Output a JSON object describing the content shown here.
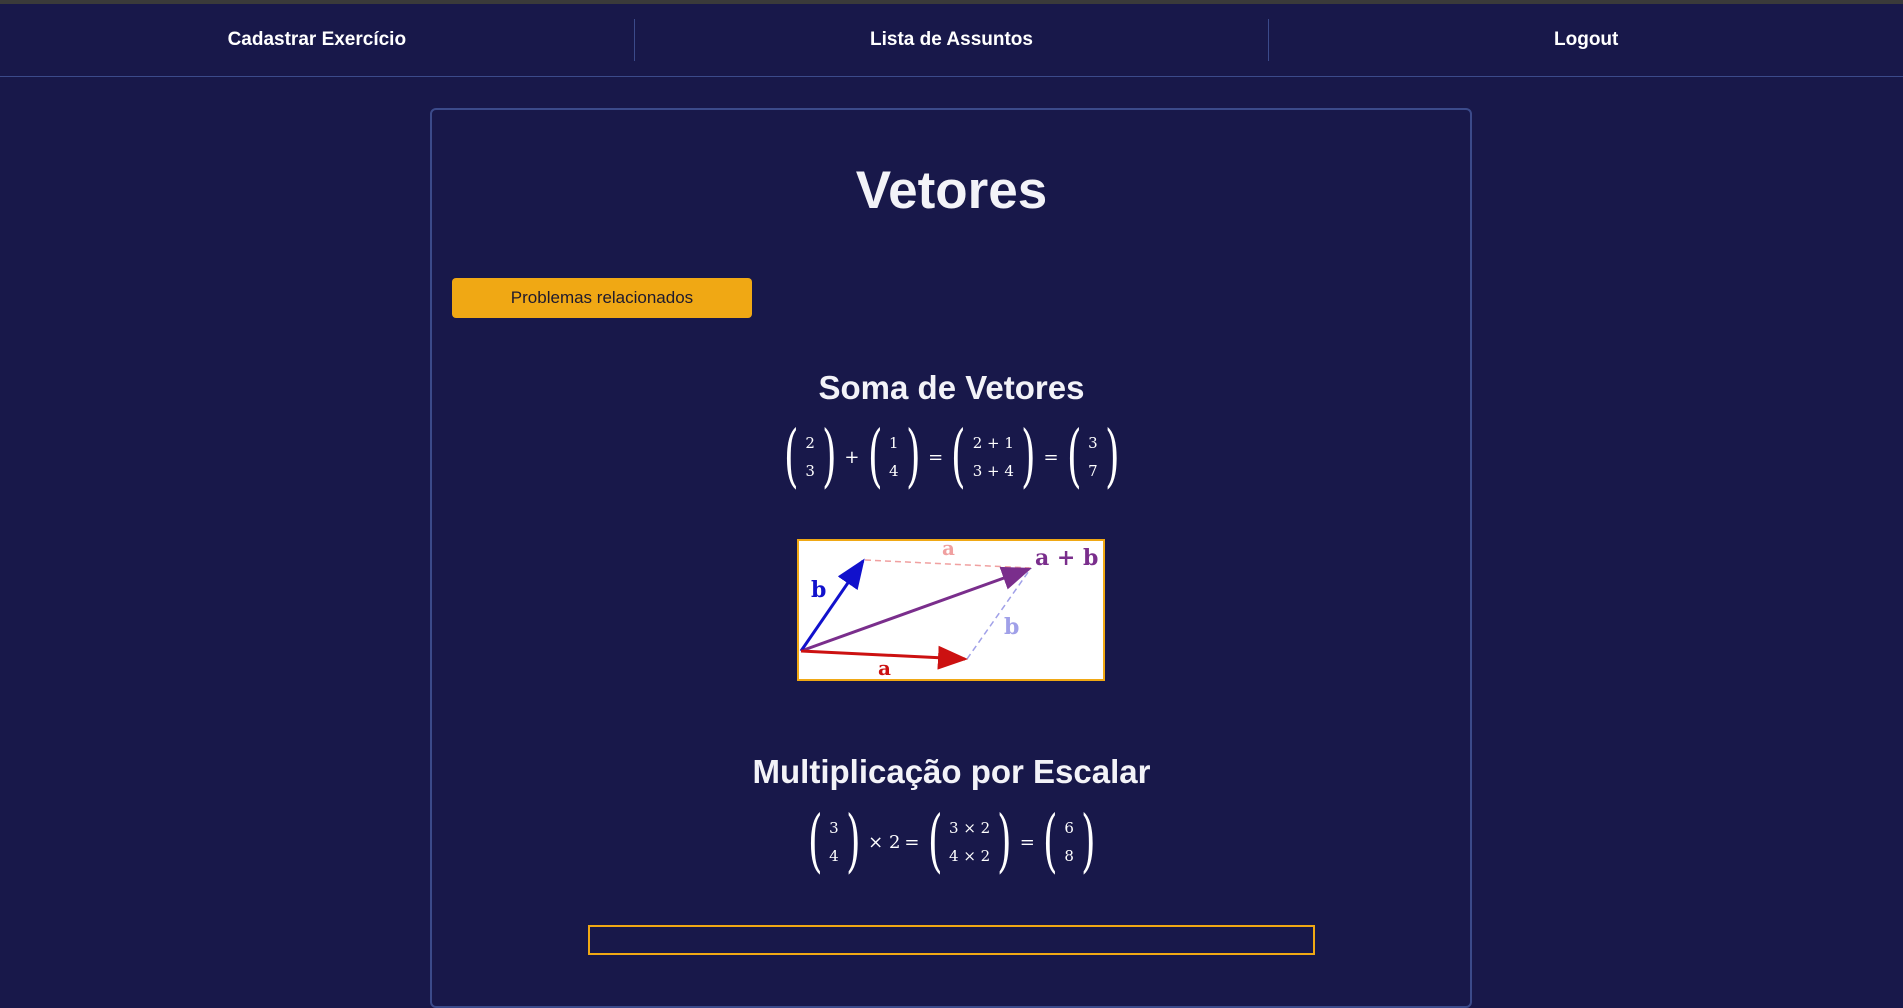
{
  "nav": {
    "items": [
      {
        "label": "Cadastrar Exercício"
      },
      {
        "label": "Lista de Assuntos"
      },
      {
        "label": "Logout"
      }
    ]
  },
  "page": {
    "title": "Vetores",
    "related_button": "Problemas relacionados"
  },
  "sections": [
    {
      "title": "Soma de Vetores",
      "formula": {
        "v1": [
          "2",
          "3"
        ],
        "op1": "+",
        "v2": [
          "1",
          "4"
        ],
        "eq1": "=",
        "v3": [
          "2 + 1",
          "3 + 4"
        ],
        "eq2": "=",
        "v4": [
          "3",
          "7"
        ]
      },
      "diagram": {
        "labels": {
          "a_top": "a",
          "a_bottom": "a",
          "b_left": "b",
          "b_right": "b",
          "sum": "a + b"
        },
        "colors": {
          "a": "#cc1111",
          "b": "#1111cc",
          "sum": "#7a2e8c",
          "a_faded": "#f0a0a0",
          "b_faded": "#a0a0e8",
          "accent": "#f0a814"
        }
      }
    },
    {
      "title": "Multiplicação por Escalar",
      "formula": {
        "v1": [
          "3",
          "4"
        ],
        "times": "× 2",
        "eq1": "=",
        "v2": [
          "3 × 2",
          "4 × 2"
        ],
        "eq2": "=",
        "v3": [
          "6",
          "8"
        ]
      }
    }
  ],
  "colors": {
    "background": "#18184a",
    "border": "#3b4a8a",
    "button": "#f0a814"
  }
}
